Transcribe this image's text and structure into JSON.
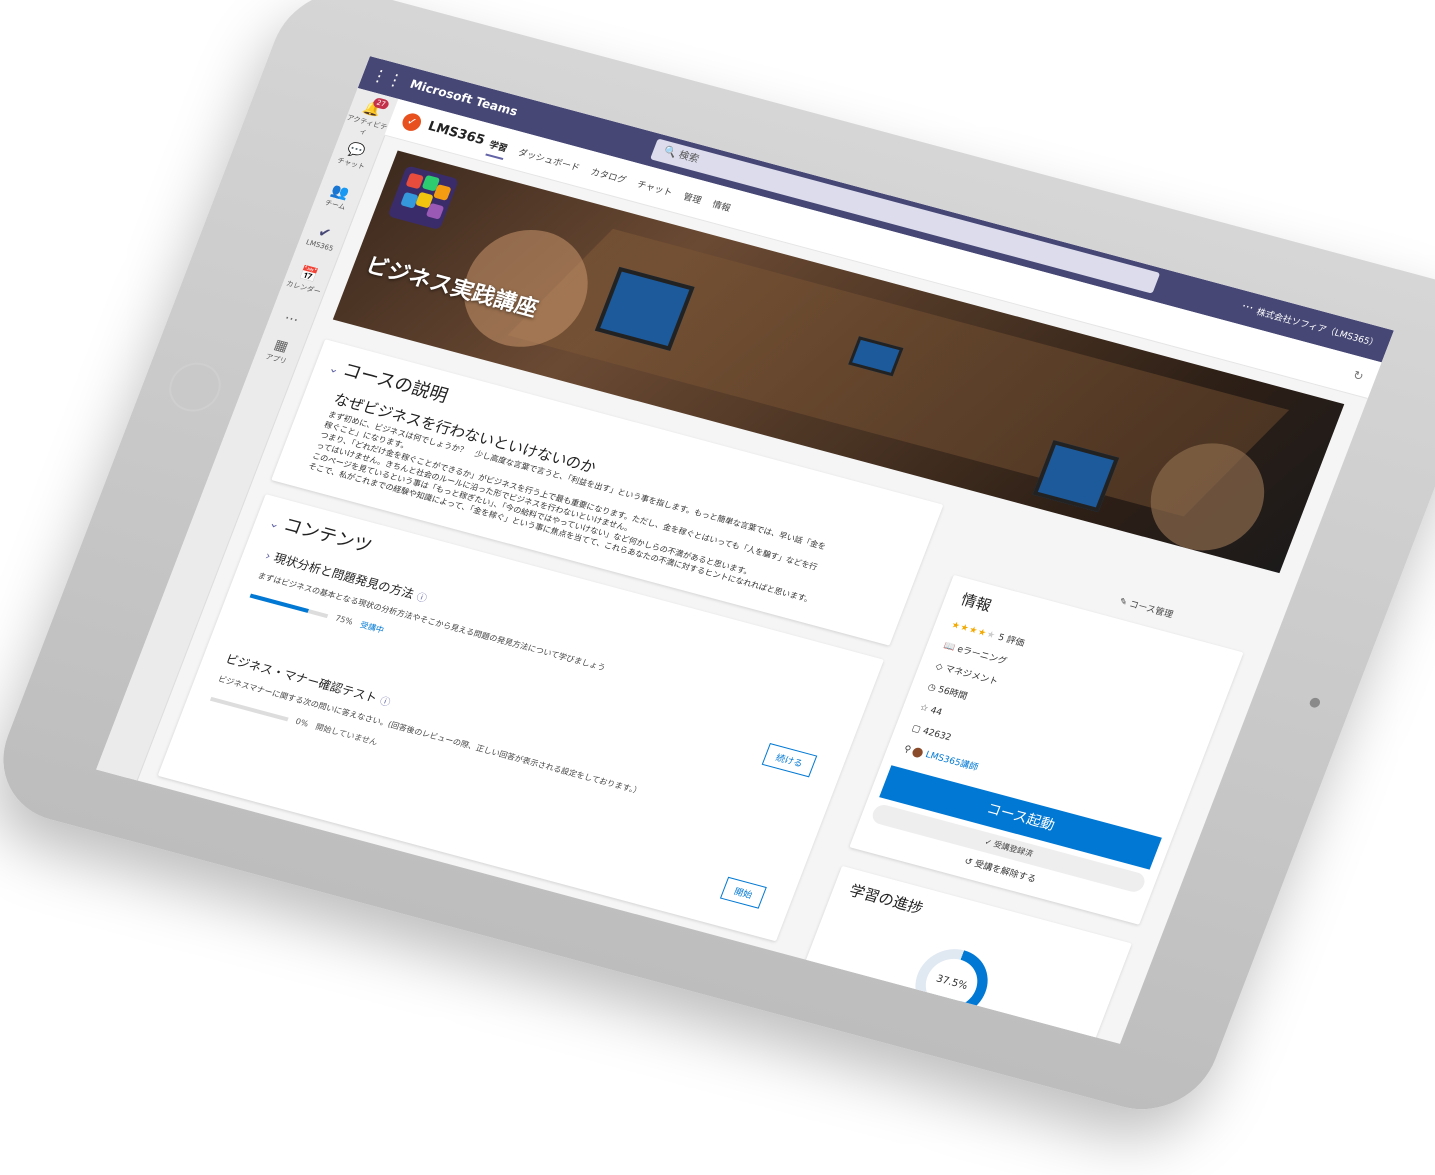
{
  "teams": {
    "title": "Microsoft Teams",
    "search_placeholder": "検索",
    "org": "株式会社ソフィア（LMS365）",
    "more": "···"
  },
  "rail": {
    "activity_badge": "27",
    "items": [
      {
        "label": "アクティビティ",
        "icon": "bell-icon"
      },
      {
        "label": "チャット",
        "icon": "chat-icon"
      },
      {
        "label": "チーム",
        "icon": "teams-icon"
      },
      {
        "label": "LMS365",
        "icon": "lms-check-icon"
      },
      {
        "label": "カレンダー",
        "icon": "calendar-icon"
      },
      {
        "label": "...",
        "icon": "more-icon"
      },
      {
        "label": "アプリ",
        "icon": "apps-icon"
      }
    ]
  },
  "app": {
    "name": "LMS365",
    "tabs": [
      "学習",
      "ダッシュボード",
      "カタログ",
      "チャット",
      "管理",
      "情報"
    ]
  },
  "hero": {
    "title": "ビジネス実践講座"
  },
  "description": {
    "section_title": "コースの説明",
    "heading": "なぜビジネスを行わないといけないのか",
    "lines": [
      "まず初めに、ビジネスは何でしょうか？　少し高度な言葉で言うと、「利益を出す」という事を指します。もっと簡単な言葉では、早い話「金を",
      "稼ぐこと」になります。",
      "つまり、「どれだけ金を稼ぐことができるか」がビジネスを行う上で最も重要になります。ただし、金を稼ぐとはいっても「人を騙す」などを行",
      "ってはいけません。きちんと社会のルールに沿った形でビジネスを行わないといけません。",
      "このページを見ているという事は「もっと稼ぎたい」、「今の給料ではやっていけない」など何かしらの不満があると思います。",
      "そこで、私がこれまでの経験や知識によって、「金を稼ぐ」という事に焦点を当てて、これらあなたの不満に対するヒントになれればと思います。"
    ]
  },
  "contents": {
    "section_title": "コンテンツ",
    "modules": [
      {
        "title": "現状分析と問題発見の方法",
        "desc": "まずはビジネスの基本となる現状の分析方法やそこから見える問題の発見方法について学びましょう",
        "progress": "75%",
        "progress_value": 0.75,
        "status": "受講中",
        "action": "続ける"
      },
      {
        "title": "ビジネス・マナー確認テスト",
        "desc": "ビジネスマナーに関する次の問いに答えなさい。(回答後のレビューの際、正しい回答が表示される設定をしております。）",
        "progress": "0%",
        "progress_value": 0,
        "status": "開始していません",
        "action": "開始"
      }
    ]
  },
  "info": {
    "manage_label": "コース管理",
    "title": "情報",
    "rating_value": 4,
    "rating_text": "5 評価",
    "type": "eラーニング",
    "category": "マネジメント",
    "duration": "56時間",
    "favorites": "44",
    "course_id": "42632",
    "instructor": "LMS365講師",
    "launch_label": "コース起動",
    "enrolled_label": "受講登録済",
    "unenroll_label": "受講を解除する"
  },
  "progress": {
    "title": "学習の進捗",
    "percent_text": "37.5%",
    "value": 0.375
  }
}
